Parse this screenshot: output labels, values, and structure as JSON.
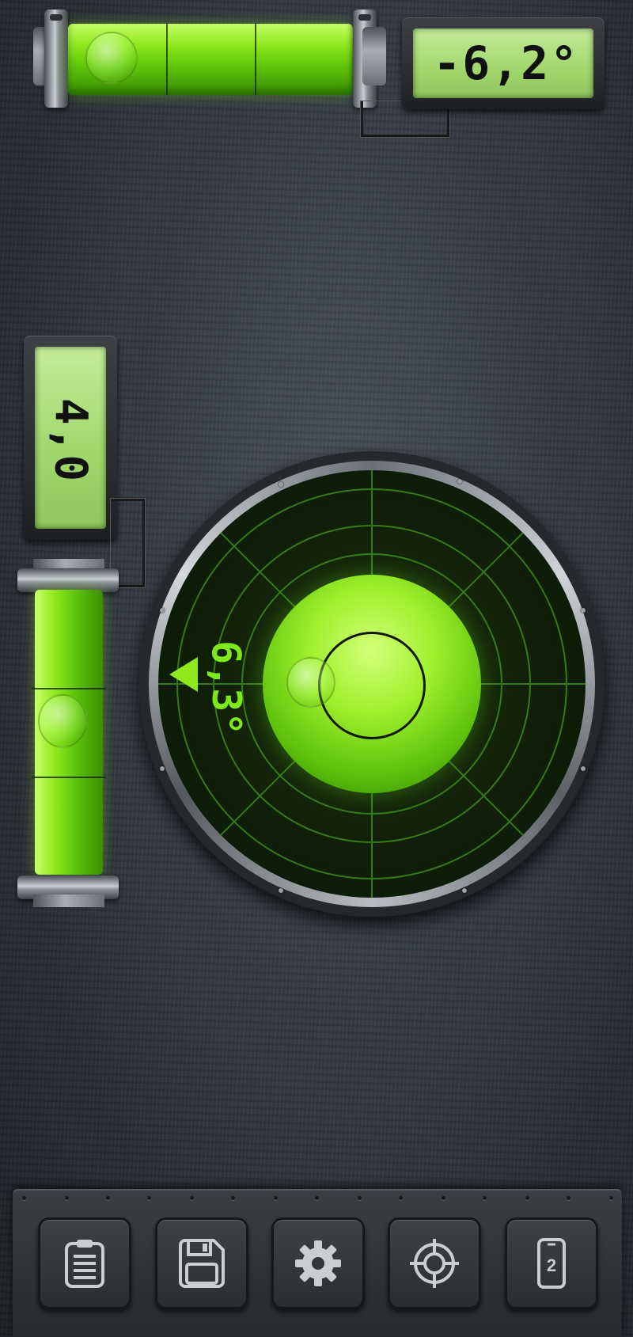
{
  "horizontal_level": {
    "reading": "-6,2°"
  },
  "vertical_level": {
    "reading": "4,0"
  },
  "circular_level": {
    "reading": "6,3°"
  },
  "toolbar": {
    "buttons": [
      {
        "icon": "clipboard-icon"
      },
      {
        "icon": "save-icon"
      },
      {
        "icon": "gear-icon"
      },
      {
        "icon": "crosshair-icon"
      },
      {
        "icon": "phone-mode-icon",
        "label": "2"
      }
    ]
  },
  "colors": {
    "accent": "#8ee81c",
    "lcd": "#a3d86f",
    "panel": "#2a2d31"
  }
}
